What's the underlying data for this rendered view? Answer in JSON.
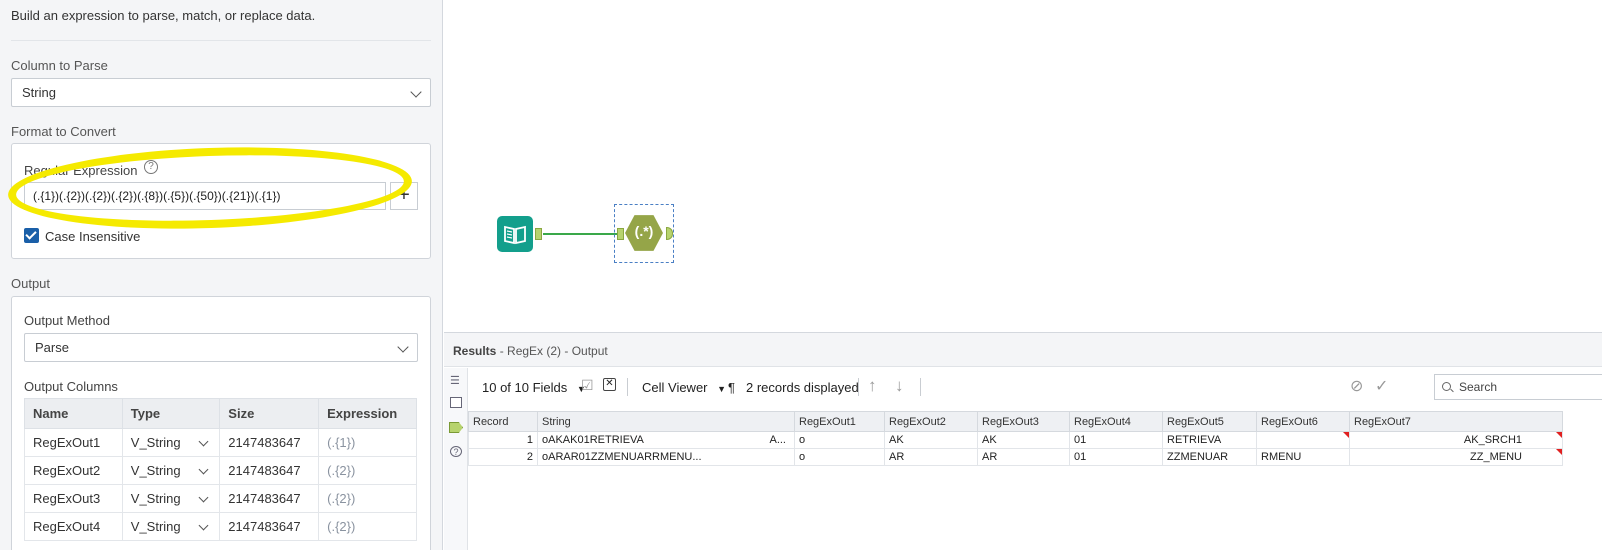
{
  "config": {
    "description": "Build an expression to parse, match, or replace data.",
    "column_to_parse_label": "Column to Parse",
    "column_to_parse_value": "String",
    "format_label": "Format to Convert",
    "regex_label": "Regular Expression",
    "regex_value": "(.{1})(.{2})(.{2})(.{2})(.{8})(.{5})(.{50})(.{21})(.{1})",
    "help_glyph": "?",
    "add_glyph": "+",
    "case_insensitive_label": "Case Insensitive",
    "case_insensitive_checked": true,
    "output_label": "Output",
    "output_method_label": "Output Method",
    "output_method_value": "Parse",
    "output_columns_label": "Output Columns",
    "columns_headers": [
      "Name",
      "Type",
      "Size",
      "Expression"
    ],
    "columns": [
      {
        "name": "RegExOut1",
        "type": "V_String",
        "size": "2147483647",
        "expr": "(.{1})"
      },
      {
        "name": "RegExOut2",
        "type": "V_String",
        "size": "2147483647",
        "expr": "(.{2})"
      },
      {
        "name": "RegExOut3",
        "type": "V_String",
        "size": "2147483647",
        "expr": "(.{2})"
      },
      {
        "name": "RegExOut4",
        "type": "V_String",
        "size": "2147483647",
        "expr": "(.{2})"
      }
    ]
  },
  "canvas": {
    "regex_node_label": "(.*)",
    "highlight_color": "#f5ea00",
    "input_node_color": "#139f8c",
    "regex_node_color": "#95a548"
  },
  "results": {
    "title": "Results",
    "subtitle": "- RegEx (2) - Output",
    "fields_label": "10 of 10 Fields",
    "cell_viewer_label": "Cell Viewer",
    "pilcrow": "¶",
    "records_label": "2 records displayed",
    "search_placeholder": "Search",
    "headers": [
      "Record",
      "String",
      "RegExOut1",
      "RegExOut2",
      "RegExOut3",
      "RegExOut4",
      "RegExOut5",
      "RegExOut6",
      "RegExOut7"
    ],
    "rows": [
      {
        "record": "1",
        "string": "oAKAK01RETRIEVA",
        "string_tail": "A...",
        "o1": "o",
        "o2": "AK",
        "o3": "AK",
        "o4": "01",
        "o5": "RETRIEVA",
        "o6": "",
        "o7": "AK_SRCH1"
      },
      {
        "record": "2",
        "string": "oARAR01ZZMENUARRMENU...",
        "string_tail": "",
        "o1": "o",
        "o2": "AR",
        "o3": "AR",
        "o4": "01",
        "o5": "ZZMENUAR",
        "o6": "RMENU",
        "o7": "ZZ_MENU"
      }
    ]
  }
}
